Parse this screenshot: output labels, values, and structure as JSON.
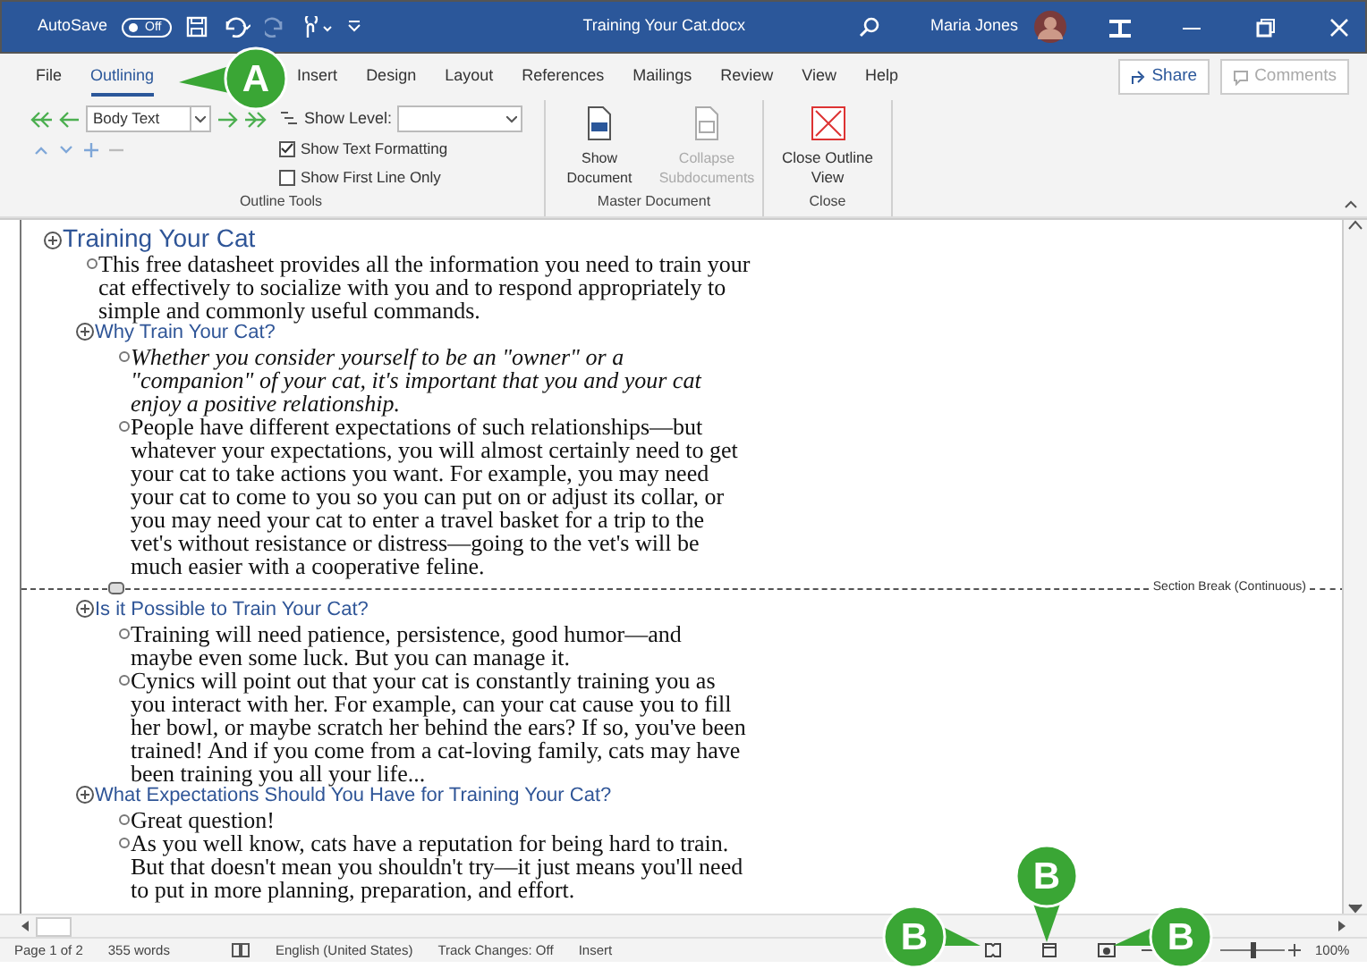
{
  "title_bar": {
    "autosave_label": "AutoSave",
    "autosave_toggle": {
      "label": "Off",
      "on": false
    },
    "document_title": "Training Your Cat.docx",
    "user_name": "Maria Jones"
  },
  "tabs": [
    {
      "label": "File",
      "selected": false
    },
    {
      "label": "Outlining",
      "selected": true
    },
    {
      "label": "Insert",
      "selected": false
    },
    {
      "label": "Design",
      "selected": false
    },
    {
      "label": "Layout",
      "selected": false
    },
    {
      "label": "References",
      "selected": false
    },
    {
      "label": "Mailings",
      "selected": false
    },
    {
      "label": "Review",
      "selected": false
    },
    {
      "label": "View",
      "selected": false
    },
    {
      "label": "Help",
      "selected": false
    }
  ],
  "share_button": {
    "label": "Share"
  },
  "comments_button": {
    "label": "Comments",
    "disabled": true
  },
  "ribbon": {
    "outline_tools": {
      "title": "Outline Tools",
      "level_select": "Body Text",
      "show_level_label": "Show Level:",
      "checkboxes": [
        {
          "label": "Show Text Formatting",
          "checked": true
        },
        {
          "label": "Show First Line Only",
          "checked": false
        }
      ]
    },
    "master_document": {
      "title": "Master Document",
      "buttons": [
        {
          "label": "Show Document",
          "disabled": false
        },
        {
          "label": "Collapse Subdocuments",
          "disabled": true
        }
      ]
    },
    "close": {
      "title": "Close",
      "button": "Close Outline View"
    }
  },
  "outline": [
    {
      "kind": "heading",
      "text": "Training Your Cat",
      "children": [
        {
          "kind": "body",
          "text": "This free datasheet provides all the information you need to train your cat effectively to socialize with you and to respond appropriately to simple and commonly useful commands.",
          "italic": false
        },
        {
          "kind": "heading",
          "text": "Why Train Your Cat?",
          "children": [
            {
              "kind": "body",
              "text": "Whether you consider yourself to be an \"owner\" or a \"companion\" of your cat, it's important that you and your cat enjoy a positive relationship.",
              "italic": true
            },
            {
              "kind": "body",
              "text": "People have different expectations of such relationships—but whatever your expectations, you will almost certainly need to get your cat to take actions you want. For example, you may need your cat to come to you so you can put on or adjust its collar, or you may need your cat to enter a travel basket for a trip to the vet's without resistance or distress—going to the vet's will be much easier with a cooperative feline.",
              "italic": false
            }
          ]
        },
        {
          "kind": "section_break",
          "text": "Section Break (Continuous)"
        },
        {
          "kind": "heading",
          "text": "Is it Possible to Train Your Cat?",
          "children": [
            {
              "kind": "body",
              "text": "Training will need patience, persistence, good humor—and maybe even some luck. But you can manage it.",
              "italic": false
            },
            {
              "kind": "body",
              "text": "Cynics will point out that your cat is constantly training you as you interact with her. For example, can your cat cause you to fill her bowl, or maybe scratch her behind the ears? If so, you've been trained! And if you come from a cat-loving family, cats may have been training you all your life...",
              "italic": false
            }
          ]
        },
        {
          "kind": "heading",
          "text": "What Expectations Should You Have for Training Your Cat?",
          "children": [
            {
              "kind": "body",
              "text": "Great question!",
              "italic": false
            },
            {
              "kind": "body",
              "text": "As you well know, cats have a reputation for being hard to train. But that doesn't mean you shouldn't try—it just means you'll need to put in more planning, preparation, and effort.",
              "italic": false
            }
          ]
        }
      ]
    }
  ],
  "status_bar": {
    "page": "Page 1 of 2",
    "words": "355 words",
    "language": "English (United States)",
    "track_changes": "Track Changes: Off",
    "mode": "Insert",
    "zoom_slider": {
      "level": 0.5
    },
    "zoom": "100%"
  },
  "callouts": [
    {
      "label": "A"
    },
    {
      "label": "B"
    },
    {
      "label": "B"
    },
    {
      "label": "B"
    }
  ]
}
